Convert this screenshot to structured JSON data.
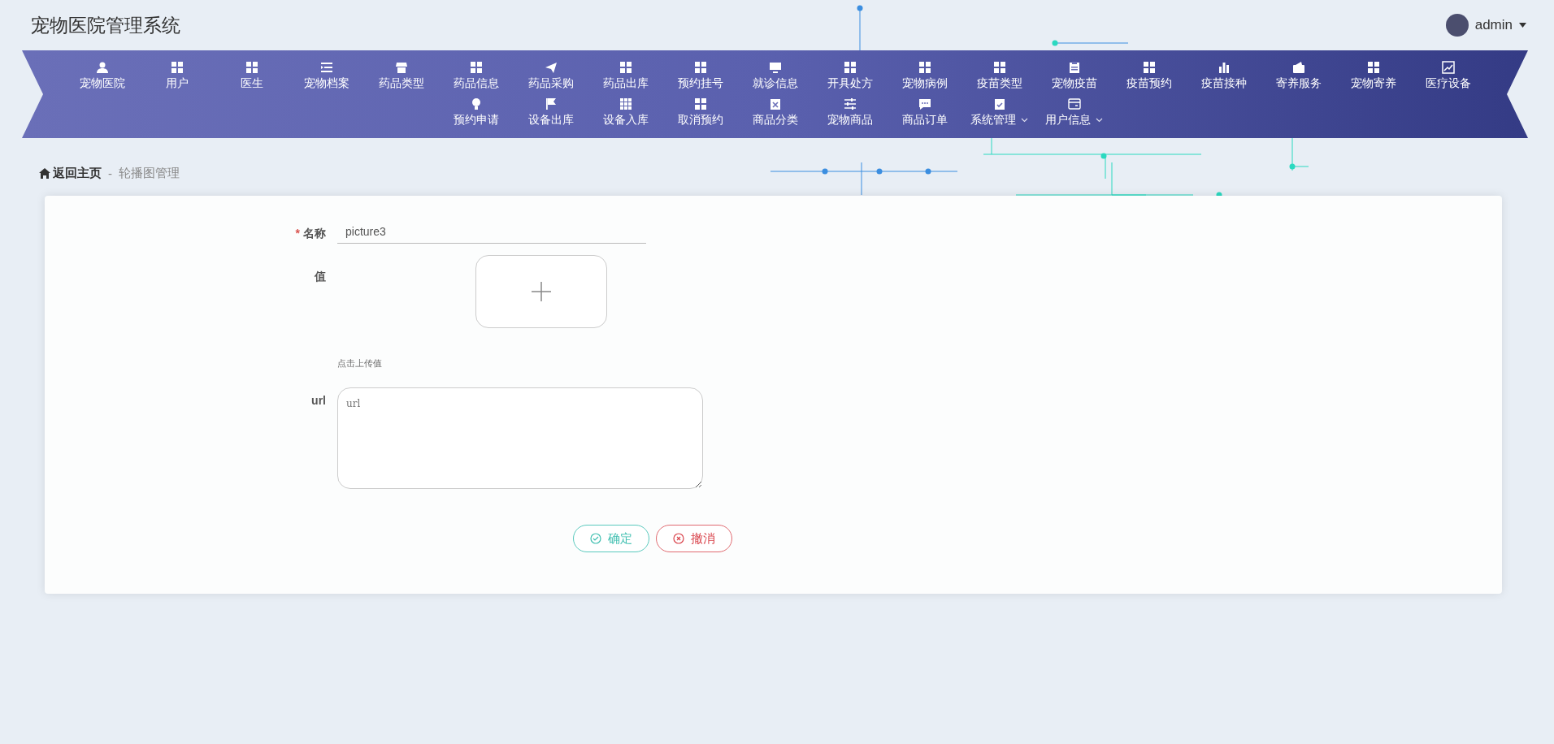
{
  "header": {
    "title": "宠物医院管理系统",
    "user": "admin"
  },
  "nav": {
    "items": [
      {
        "label": "宠物医院",
        "dropdown": false
      },
      {
        "label": "用户",
        "dropdown": false
      },
      {
        "label": "医生",
        "dropdown": false
      },
      {
        "label": "宠物档案",
        "dropdown": false
      },
      {
        "label": "药品类型",
        "dropdown": false
      },
      {
        "label": "药品信息",
        "dropdown": false
      },
      {
        "label": "药品采购",
        "dropdown": false
      },
      {
        "label": "药品出库",
        "dropdown": false
      },
      {
        "label": "预约挂号",
        "dropdown": false
      },
      {
        "label": "就诊信息",
        "dropdown": false
      },
      {
        "label": "开具处方",
        "dropdown": false
      },
      {
        "label": "宠物病例",
        "dropdown": false
      },
      {
        "label": "疫苗类型",
        "dropdown": false
      },
      {
        "label": "宠物疫苗",
        "dropdown": false
      },
      {
        "label": "疫苗预约",
        "dropdown": false
      },
      {
        "label": "疫苗接种",
        "dropdown": false
      },
      {
        "label": "寄养服务",
        "dropdown": false
      },
      {
        "label": "宠物寄养",
        "dropdown": false
      },
      {
        "label": "医疗设备",
        "dropdown": false
      },
      {
        "label": "预约申请",
        "dropdown": false
      },
      {
        "label": "设备出库",
        "dropdown": false
      },
      {
        "label": "设备入库",
        "dropdown": false
      },
      {
        "label": "取消预约",
        "dropdown": false
      },
      {
        "label": "商品分类",
        "dropdown": false
      },
      {
        "label": "宠物商品",
        "dropdown": false
      },
      {
        "label": "商品订单",
        "dropdown": false
      },
      {
        "label": "系统管理",
        "dropdown": true
      },
      {
        "label": "用户信息",
        "dropdown": true
      }
    ]
  },
  "breadcrumb": {
    "home": "返回主页",
    "separator": "-",
    "current": "轮播图管理"
  },
  "form": {
    "required_marker": "*",
    "name": {
      "label": "名称",
      "required": true,
      "value": "picture3"
    },
    "value": {
      "label": "值",
      "required": false,
      "hint": "点击上传值"
    },
    "url": {
      "label": "url",
      "required": false,
      "placeholder": "url"
    },
    "buttons": [
      {
        "label": "确定",
        "kind": "confirm"
      },
      {
        "label": "撤消",
        "kind": "cancel"
      }
    ]
  }
}
